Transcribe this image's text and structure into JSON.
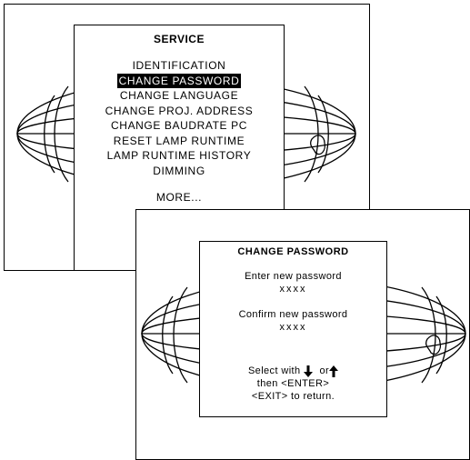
{
  "service_screen": {
    "title": "SERVICE",
    "items": [
      {
        "label": "IDENTIFICATION"
      },
      {
        "label": "CHANGE PASSWORD",
        "selected": true
      },
      {
        "label": "CHANGE LANGUAGE"
      },
      {
        "label": "CHANGE PROJ. ADDRESS"
      },
      {
        "label": "CHANGE BAUDRATE PC"
      },
      {
        "label": "RESET LAMP RUNTIME"
      },
      {
        "label": "LAMP RUNTIME HISTORY"
      },
      {
        "label": "DIMMING"
      }
    ],
    "more": "MORE..."
  },
  "password_screen": {
    "title": "CHANGE PASSWORD",
    "enter_label": "Enter new password",
    "enter_value": "xxxx",
    "confirm_label": "Confirm new password",
    "confirm_value": "xxxx",
    "help_select": "Select with",
    "help_or": "or",
    "help_enter": "then <ENTER>",
    "help_exit": "<EXIT> to return."
  },
  "icons": {
    "down": "arrow-down-icon",
    "up": "arrow-up-icon",
    "background": "globe-icon"
  }
}
